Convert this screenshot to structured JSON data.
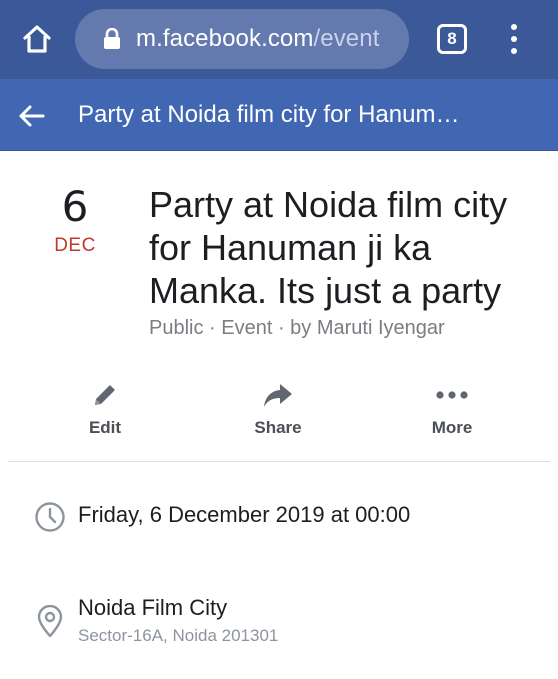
{
  "browser": {
    "url_host": "m.facebook.com",
    "url_path": "/event",
    "tab_count": "8",
    "icons": {
      "home": "home-icon",
      "lock": "lock-icon",
      "menu": "kebab-menu-icon"
    },
    "color": "#3b5998"
  },
  "header": {
    "title": "Party at Noida film city for Hanum…",
    "back_icon": "back-arrow-icon",
    "color": "#4267b2"
  },
  "event": {
    "day": "6",
    "month": "DEC",
    "title": "Party at Noida film city for Hanuman ji ka Manka. Its just a party",
    "meta": "Public · Event · by Maruti Iyengar",
    "month_color": "#c0392b"
  },
  "actions": [
    {
      "label": "Edit",
      "icon": "pencil-icon"
    },
    {
      "label": "Share",
      "icon": "share-arrow-icon"
    },
    {
      "label": "More",
      "icon": "more-dots-icon"
    }
  ],
  "details": {
    "when": {
      "icon": "clock-icon",
      "text": "Friday, 6 December 2019 at 00:00"
    },
    "where": {
      "icon": "location-pin-icon",
      "name": "Noida Film City",
      "address": "Sector-16A, Noida 201301"
    }
  }
}
